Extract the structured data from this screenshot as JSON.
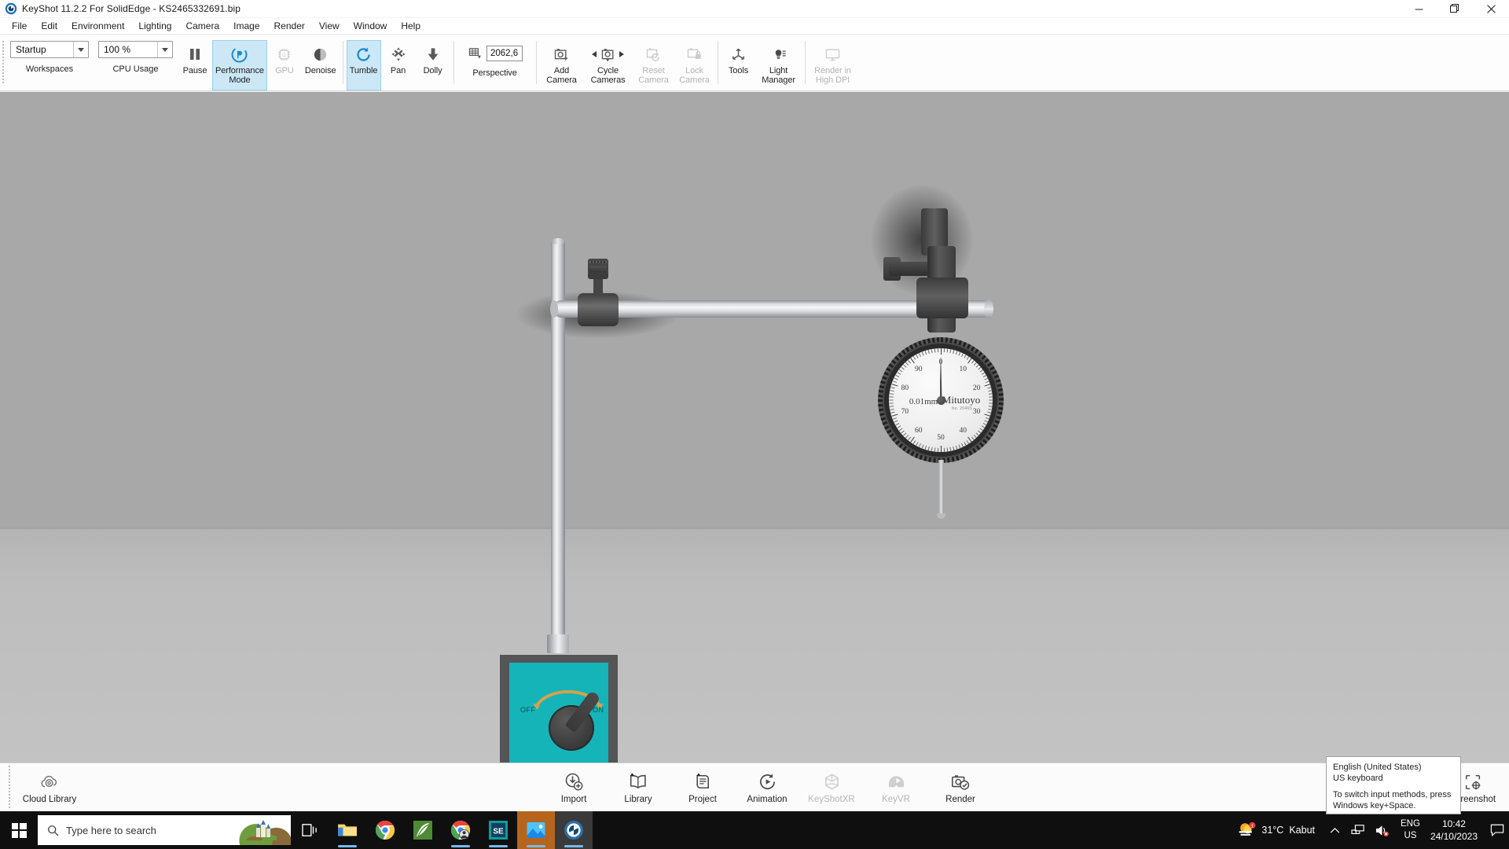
{
  "window": {
    "title": "KeyShot 11.2.2 For SolidEdge - KS2465332691.bip",
    "app_icon": "keyshot-logo-icon",
    "minimize": "–",
    "maximize": "❐",
    "close": "✕"
  },
  "menu": {
    "items": [
      {
        "label": "File"
      },
      {
        "label": "Edit"
      },
      {
        "label": "Environment"
      },
      {
        "label": "Lighting"
      },
      {
        "label": "Camera"
      },
      {
        "label": "Image"
      },
      {
        "label": "Render"
      },
      {
        "label": "View"
      },
      {
        "label": "Window"
      },
      {
        "label": "Help"
      }
    ]
  },
  "ribbon": {
    "workspace": {
      "value": "Startup",
      "label": "Workspaces",
      "icon": "chevron-down-icon"
    },
    "cpu_usage": {
      "value": "100 %",
      "label": "CPU Usage",
      "icon": "chevron-down-icon"
    },
    "pause": {
      "label": "Pause",
      "icon": "pause-icon",
      "state": "enabled"
    },
    "performance_mode": {
      "label": "Performance\nMode",
      "label_line1": "Performance",
      "label_line2": "Mode",
      "icon": "performance-mode-icon",
      "state": "active"
    },
    "gpu": {
      "label": "GPU",
      "icon": "gpu-chip-icon",
      "state": "disabled"
    },
    "denoise": {
      "label": "Denoise",
      "icon": "denoise-sphere-icon",
      "state": "enabled"
    },
    "tumble": {
      "label": "Tumble",
      "icon": "tumble-rotate-icon",
      "state": "active"
    },
    "pan": {
      "label": "Pan",
      "icon": "pan-move-icon",
      "state": "enabled"
    },
    "dolly": {
      "label": "Dolly",
      "icon": "dolly-arrow-icon",
      "state": "enabled"
    },
    "perspective": {
      "label": "Perspective",
      "icon": "perspective-grid-icon",
      "value": "2062,6"
    },
    "add_camera": {
      "label_line1": "Add",
      "label_line2": "Camera",
      "icon": "add-camera-icon",
      "state": "enabled"
    },
    "cycle_cameras": {
      "label_line1": "Cycle",
      "label_line2": "Cameras",
      "icon": "cycle-camera-icon",
      "prev_icon": "triangle-left-icon",
      "next_icon": "triangle-right-icon",
      "state": "enabled"
    },
    "reset_camera": {
      "label_line1": "Reset",
      "label_line2": "Camera",
      "icon": "reset-camera-icon",
      "state": "disabled"
    },
    "lock_camera": {
      "label_line1": "Lock",
      "label_line2": "Camera",
      "icon": "lock-camera-icon",
      "state": "disabled"
    },
    "tools": {
      "label": "Tools",
      "icon": "tools-axis-icon",
      "state": "enabled"
    },
    "light_manager": {
      "label_line1": "Light",
      "label_line2": "Manager",
      "icon": "light-manager-icon",
      "state": "enabled"
    },
    "render_high_dpi": {
      "label_line1": "Render in",
      "label_line2": "High DPI",
      "icon": "monitor-icon",
      "state": "disabled"
    }
  },
  "viewport": {
    "scene_name": "dial-indicator-magnetic-base-scene",
    "background_color": "#a8a8a8",
    "floor_color": "#bdbdbd",
    "dial_indicator": {
      "brand": "Mitutoyo",
      "resolution": "0.01mm",
      "model_sub": "No. 2046S",
      "needle_angle_deg": 0,
      "scale_numbers": [
        "0",
        "10",
        "20",
        "30",
        "40",
        "50",
        "60",
        "70",
        "80",
        "90"
      ],
      "bezel_color": "#2b2b2b",
      "face_color": "#eeeeee"
    },
    "magnetic_base": {
      "face_color": "#15b4b9",
      "label_off": "OFF",
      "label_on": "ON",
      "arc_color": "#d2a34e",
      "knob_color": "#3c3c3c"
    }
  },
  "bottom_toolbar": {
    "cloud_library": {
      "label": "Cloud Library",
      "icon": "cloud-library-icon",
      "state": "enabled"
    },
    "items": [
      {
        "label": "Import",
        "icon": "import-icon",
        "state": "enabled"
      },
      {
        "label": "Library",
        "icon": "library-book-icon",
        "state": "enabled"
      },
      {
        "label": "Project",
        "icon": "project-document-icon",
        "state": "enabled"
      },
      {
        "label": "Animation",
        "icon": "animation-play-icon",
        "state": "enabled"
      },
      {
        "label": "KeyShotXR",
        "icon": "keyshotxr-cube-icon",
        "state": "disabled"
      },
      {
        "label": "KeyVR",
        "icon": "keyvr-headset-icon",
        "state": "disabled"
      },
      {
        "label": "Render",
        "icon": "render-check-icon",
        "state": "enabled"
      }
    ],
    "screenshot": {
      "label": "Screenshot",
      "icon": "screenshot-crosshair-icon",
      "state": "enabled"
    }
  },
  "ime_tooltip": {
    "line1": "English (United States)",
    "line2": "US keyboard",
    "line3": "To switch input methods, press",
    "line4": "Windows key+Space."
  },
  "taskbar": {
    "start": {
      "icon": "windows-start-icon"
    },
    "search": {
      "placeholder": "Type here to search",
      "icon": "search-icon"
    },
    "task_view": {
      "icon": "task-view-icon"
    },
    "pinned": [
      {
        "name": "file-explorer",
        "icon": "file-explorer-icon",
        "running": true,
        "active": false
      },
      {
        "name": "google-chrome",
        "icon": "chrome-icon",
        "running": false,
        "active": false
      },
      {
        "name": "green-app",
        "icon": "green-leaf-icon",
        "running": false,
        "active": false
      },
      {
        "name": "chrome-window",
        "icon": "chrome-badge-icon",
        "running": true,
        "active": false
      },
      {
        "name": "solid-edge",
        "icon": "solid-edge-icon",
        "running": true,
        "active": false
      },
      {
        "name": "photos",
        "icon": "photos-icon",
        "running": true,
        "active": true
      },
      {
        "name": "keyshot",
        "icon": "keyshot-icon",
        "running": true,
        "active": true
      }
    ],
    "tray": {
      "weather_temp": "31°C",
      "weather_desc": "Kabut",
      "weather_icon": "weather-fog-icon",
      "chevron": "show-hidden-icons-icon",
      "network": "network-icon",
      "volume": "volume-muted-icon",
      "lang_line1": "ENG",
      "lang_line2": "US",
      "time": "10:42",
      "date": "24/10/2023",
      "notifications": "action-center-icon"
    }
  }
}
